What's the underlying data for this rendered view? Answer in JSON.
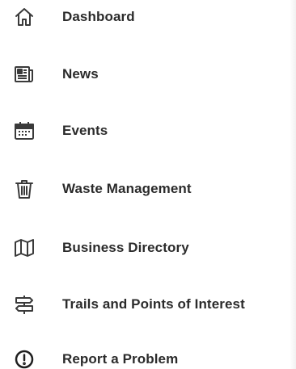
{
  "menu": {
    "items": [
      {
        "label": "Dashboard",
        "icon": "home-icon"
      },
      {
        "label": "News",
        "icon": "newspaper-icon"
      },
      {
        "label": "Events",
        "icon": "calendar-icon"
      },
      {
        "label": "Waste Management",
        "icon": "trash-icon"
      },
      {
        "label": "Business Directory",
        "icon": "map-icon"
      },
      {
        "label": "Trails and Points of Interest",
        "icon": "signpost-icon"
      },
      {
        "label": "Report a Problem",
        "icon": "alert-circle-icon"
      }
    ]
  },
  "colors": {
    "text": "#2b2b2b",
    "icon": "#3a3a3a",
    "background": "#ffffff"
  }
}
